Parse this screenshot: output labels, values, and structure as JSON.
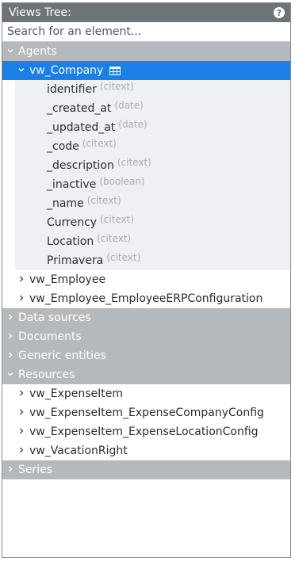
{
  "header": {
    "title": "Views Tree:",
    "help_icon": "help-icon",
    "help_symbol": "?"
  },
  "search": {
    "placeholder": "Search for an element..."
  },
  "sections": {
    "agents": {
      "label": "Agents",
      "items": [
        {
          "label": "vw_Company",
          "fields": [
            {
              "name": "identifier",
              "type": "(citext)"
            },
            {
              "name": "_created_at",
              "type": "(date)"
            },
            {
              "name": "_updated_at",
              "type": "(date)"
            },
            {
              "name": "_code",
              "type": "(citext)"
            },
            {
              "name": "_description",
              "type": "(citext)"
            },
            {
              "name": "_inactive",
              "type": "(boolean)"
            },
            {
              "name": "_name",
              "type": "(citext)"
            },
            {
              "name": "Currency",
              "type": "(citext)"
            },
            {
              "name": "Location",
              "type": "(citext)"
            },
            {
              "name": "Primavera",
              "type": "(citext)"
            }
          ]
        },
        {
          "label": "vw_Employee"
        },
        {
          "label": "vw_Employee_EmployeeERPConfiguration"
        }
      ]
    },
    "data_sources": {
      "label": "Data sources"
    },
    "documents": {
      "label": "Documents"
    },
    "generic_entities": {
      "label": "Generic entities"
    },
    "resources": {
      "label": "Resources",
      "items": [
        {
          "label": "vw_ExpenseItem"
        },
        {
          "label": "vw_ExpenseItem_ExpenseCompanyConfig"
        },
        {
          "label": "vw_ExpenseItem_ExpenseLocationConfig"
        },
        {
          "label": "vw_VacationRight"
        }
      ]
    },
    "series": {
      "label": "Series"
    }
  },
  "colors": {
    "titlebar": "#6d7478",
    "section": "#b3b9bd",
    "selected": "#1a7fe6",
    "fields_bg": "#eef0f3"
  }
}
